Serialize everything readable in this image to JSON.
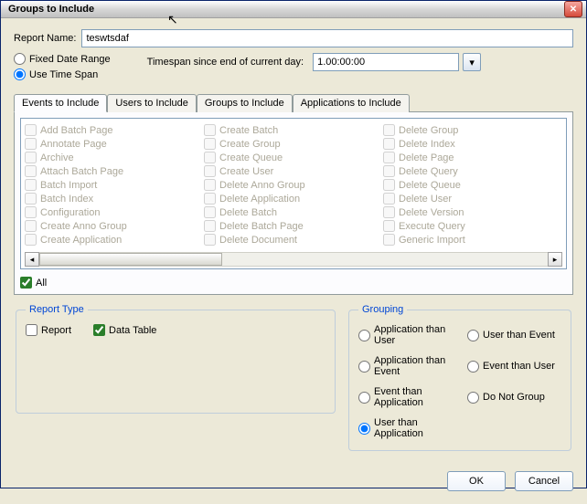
{
  "window": {
    "title": "Groups to Include"
  },
  "reportName": {
    "label": "Report Name:",
    "value": "teswtsdaf"
  },
  "dateMode": {
    "fixed": "Fixed Date Range",
    "span": "Use Time Span",
    "selected": "span",
    "timespanLabel": "Timespan since end of current day:",
    "timespanValue": "1.00:00:00"
  },
  "tabs": {
    "events": "Events to Include",
    "users": "Users to Include",
    "groups": "Groups to Include",
    "apps": "Applications to Include",
    "active": "events"
  },
  "eventsCols": [
    [
      "Add Batch Page",
      "Annotate Page",
      "Archive",
      "Attach Batch Page",
      "Batch Import",
      "Batch Index",
      "Configuration",
      "Create Anno Group",
      "Create Application"
    ],
    [
      "Create Batch",
      "Create Group",
      "Create Queue",
      "Create User",
      "Delete Anno Group",
      "Delete Application",
      "Delete Batch",
      "Delete Batch Page",
      "Delete Document"
    ],
    [
      "Delete Group",
      "Delete Index",
      "Delete Page",
      "Delete Query",
      "Delete Queue",
      "Delete User",
      "Delete Version",
      "Execute Query",
      "Generic Import"
    ]
  ],
  "allLabel": "All",
  "reportType": {
    "legend": "Report Type",
    "report": "Report",
    "dataTable": "Data Table"
  },
  "grouping": {
    "legend": "Grouping",
    "opts": {
      "appUser": "Application than User",
      "appEvent": "Application than Event",
      "eventApp": "Event than Application",
      "userApp": "User than Application",
      "userEvent": "User than Event",
      "eventUser": "Event than User",
      "noGroup": "Do Not Group"
    },
    "selected": "userApp"
  },
  "buttons": {
    "ok": "OK",
    "cancel": "Cancel"
  }
}
